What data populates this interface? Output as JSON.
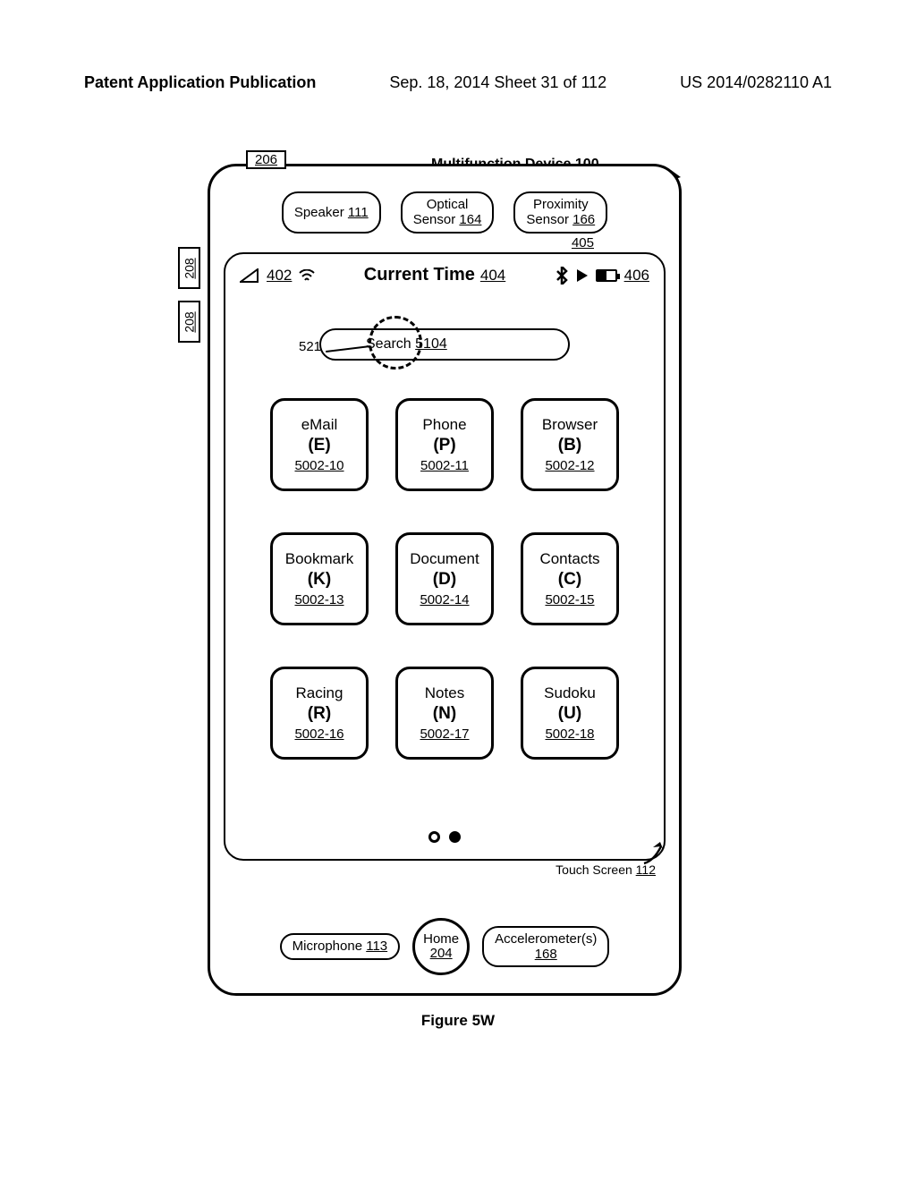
{
  "header": {
    "left": "Patent Application Publication",
    "center": "Sep. 18, 2014  Sheet 31 of 112",
    "right": "US 2014/0282110 A1"
  },
  "device_title": "Multifunction Device 100",
  "refs": {
    "r206": "206",
    "r208": "208",
    "r405": "405",
    "touch_screen": "Touch Screen",
    "touch_screen_ref": "112"
  },
  "top_sensors": {
    "speaker": {
      "label": "Speaker",
      "ref": "111"
    },
    "optical": {
      "label": "Optical",
      "label2": "Sensor",
      "ref": "164"
    },
    "proximity": {
      "label": "Proximity",
      "label2": "Sensor",
      "ref": "166"
    }
  },
  "status": {
    "signal_ref": "402",
    "time_label": "Current Time",
    "time_ref": "404",
    "batt_ref": "406"
  },
  "search": {
    "pointer_label": "521",
    "label": "Search",
    "ref": "5104"
  },
  "apps": [
    {
      "name": "eMail",
      "letter": "(E)",
      "ref": "5002-10"
    },
    {
      "name": "Phone",
      "letter": "(P)",
      "ref": "5002-11"
    },
    {
      "name": "Browser",
      "letter": "(B)",
      "ref": "5002-12"
    },
    {
      "name": "Bookmark",
      "letter": "(K)",
      "ref": "5002-13"
    },
    {
      "name": "Document",
      "letter": "(D)",
      "ref": "5002-14"
    },
    {
      "name": "Contacts",
      "letter": "(C)",
      "ref": "5002-15"
    },
    {
      "name": "Racing",
      "letter": "(R)",
      "ref": "5002-16"
    },
    {
      "name": "Notes",
      "letter": "(N)",
      "ref": "5002-17"
    },
    {
      "name": "Sudoku",
      "letter": "(U)",
      "ref": "5002-18"
    }
  ],
  "bottom_sensors": {
    "mic": {
      "label": "Microphone",
      "ref": "113"
    },
    "home": {
      "label": "Home",
      "ref": "204"
    },
    "accel": {
      "label": "Accelerometer(s)",
      "ref": "168"
    }
  },
  "caption": "Figure 5W"
}
